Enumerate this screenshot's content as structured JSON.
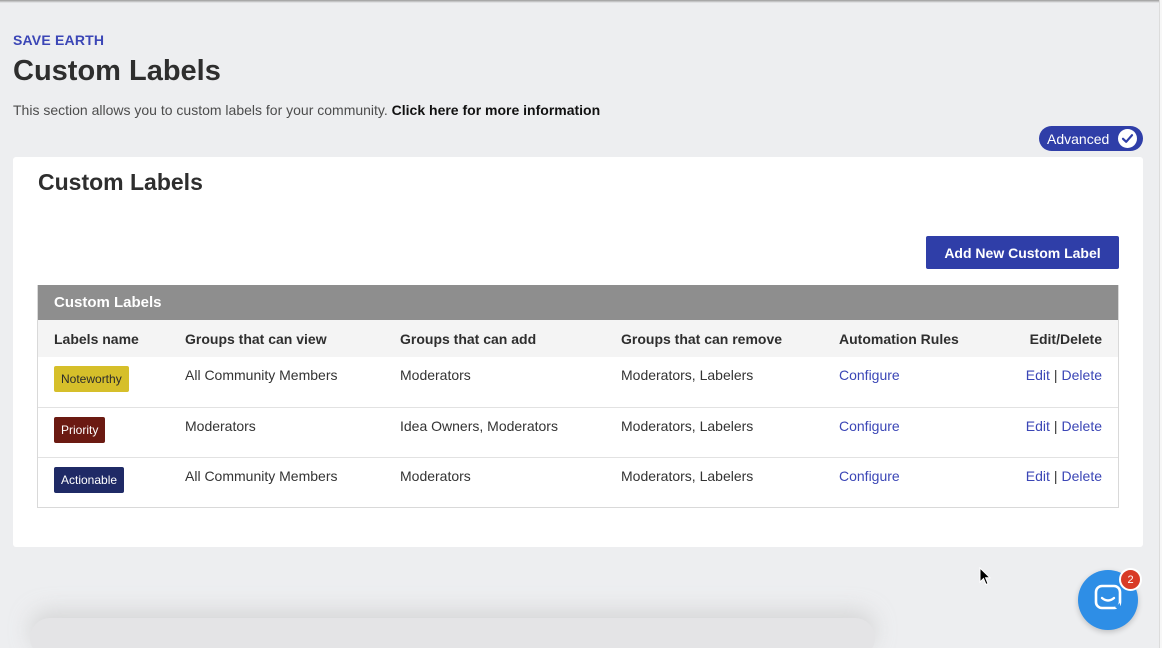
{
  "header": {
    "org_name": "SAVE EARTH",
    "title": "Custom Labels",
    "description": "This section allows you to custom labels for your community.",
    "more_info_link": "Click here for more information"
  },
  "advanced_badge": {
    "label": "Advanced",
    "icon": "check-circle-icon"
  },
  "card": {
    "title": "Custom Labels",
    "add_button_label": "Add New Custom Label",
    "table": {
      "caption": "Custom Labels",
      "columns": [
        "Labels name",
        "Groups that can view",
        "Groups that can add",
        "Groups that can remove",
        "Automation Rules",
        "Edit/Delete"
      ],
      "rows": [
        {
          "label": {
            "text": "Noteworthy",
            "bg": "#d6bf2a",
            "fg": "#2b2b2b"
          },
          "view": "All Community Members",
          "add": "Moderators",
          "remove": "Moderators, Labelers",
          "automation": "Configure",
          "edit": "Edit",
          "delete": "Delete"
        },
        {
          "label": {
            "text": "Priority",
            "bg": "#6b1a12",
            "fg": "#ffffff"
          },
          "view": "Moderators",
          "add": "Idea Owners, Moderators",
          "remove": "Moderators, Labelers",
          "automation": "Configure",
          "edit": "Edit",
          "delete": "Delete"
        },
        {
          "label": {
            "text": "Actionable",
            "bg": "#1f2a66",
            "fg": "#ffffff"
          },
          "view": "All Community Members",
          "add": "Moderators",
          "remove": "Moderators, Labelers",
          "automation": "Configure",
          "edit": "Edit",
          "delete": "Delete"
        }
      ]
    }
  },
  "chat": {
    "icon": "chat-bubble-icon",
    "unread_count": "2"
  },
  "colors": {
    "accent": "#2f3ea8",
    "link": "#3b46b6",
    "chat": "#2e8ee6",
    "badge": "#d83a26"
  }
}
